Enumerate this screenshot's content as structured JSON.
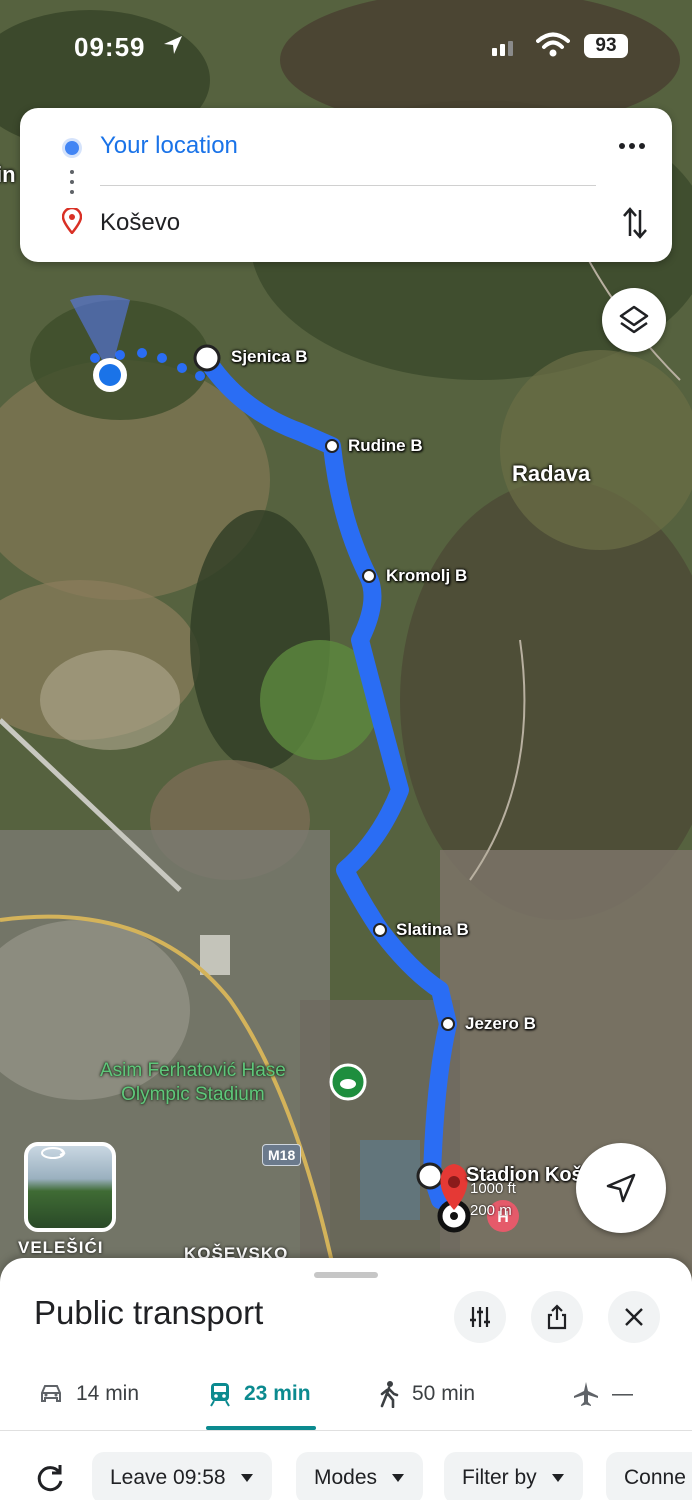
{
  "status_bar": {
    "time": "09:59",
    "battery": "93"
  },
  "directions": {
    "origin": "Your location",
    "destination": "Koševo"
  },
  "map": {
    "stops": [
      "Sjenica B",
      "Rudine B",
      "Kromolj B",
      "Slatina B",
      "Jezero B",
      "Stadion Koš"
    ],
    "places": {
      "radava": "Radava",
      "velesici": "VELEŠIĆI",
      "kosevsko": "KOŠEVSKO",
      "edge": "in"
    },
    "poi": {
      "line1": "Asim Ferhatović Hase",
      "line2": "Olympic Stadium"
    },
    "road_shield": "M18",
    "scale": {
      "top": "1000 ft",
      "bottom": "200 m"
    },
    "route_color": "#2a6df4"
  },
  "sheet": {
    "title": "Public transport",
    "tabs": [
      {
        "mode": "car",
        "label": "14 min"
      },
      {
        "mode": "transit",
        "label": "23 min"
      },
      {
        "mode": "walk",
        "label": "50 min"
      },
      {
        "mode": "flight",
        "label": "—"
      }
    ],
    "chips": {
      "leave": "Leave 09:58",
      "modes": "Modes",
      "filter": "Filter by",
      "connections": "Conne"
    }
  }
}
